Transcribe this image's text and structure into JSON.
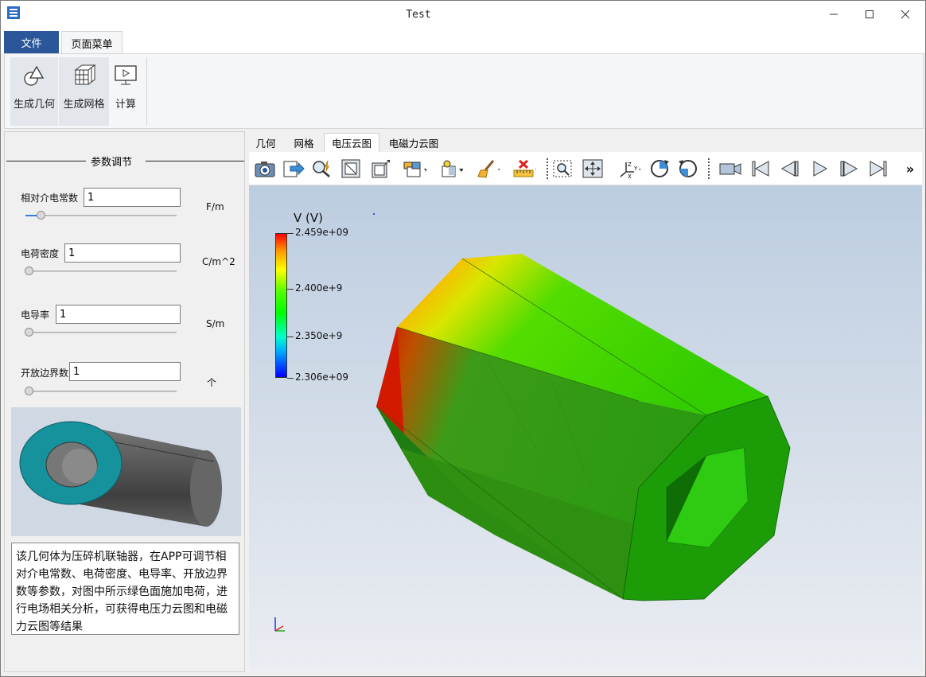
{
  "window": {
    "title": "Test"
  },
  "ribbon": {
    "tabs": [
      "文件",
      "页面菜单"
    ],
    "buttons": [
      "生成几何",
      "生成网格",
      "计算"
    ]
  },
  "params": {
    "group_title": "参数调节",
    "fields": [
      {
        "label": "相对介电常数",
        "value": "1",
        "unit": "F/m",
        "slider_fraction": 0.08
      },
      {
        "label": "电荷密度",
        "value": "1",
        "unit": "C/m^2",
        "slider_fraction": 0.0
      },
      {
        "label": "电导率",
        "value": "1",
        "unit": "S/m",
        "slider_fraction": 0.0
      },
      {
        "label": "开放边界数",
        "value": "1",
        "unit": "个",
        "slider_fraction": 0.0
      }
    ],
    "description": "该几何体为压碎机联轴器，在APP可调节相对介电常数、电荷密度、电导率、开放边界数等参数，对图中所示绿色面施加电荷，进行电场相关分析，可获得电压力云图和电磁力云图等结果"
  },
  "view_tabs": [
    "几何",
    "网格",
    "电压云图",
    "电磁力云图"
  ],
  "active_view_tab": "电压云图",
  "toolbar": {
    "icons": [
      "camera-icon",
      "export-icon",
      "magic-query-icon",
      "fit-view-icon",
      "resize-view-icon",
      "display-mode-icon",
      "color-mode-icon",
      "clear-brush-icon",
      "delete-measure-icon",
      "zoom-box-icon",
      "pan-icon",
      "axes-icon",
      "rotate-cw-icon",
      "rotate-ccw-icon",
      "video-camera-icon",
      "first-frame-icon",
      "prev-frame-icon",
      "play-icon",
      "next-frame-icon",
      "last-frame-icon"
    ],
    "overflow": "»"
  },
  "legend": {
    "title": "V (V)",
    "labels": [
      "2.459e+09",
      "2.400e+9",
      "2.350e+9",
      "2.306e+09"
    ],
    "max": 2459000000.0,
    "min": 2306000000.0
  }
}
